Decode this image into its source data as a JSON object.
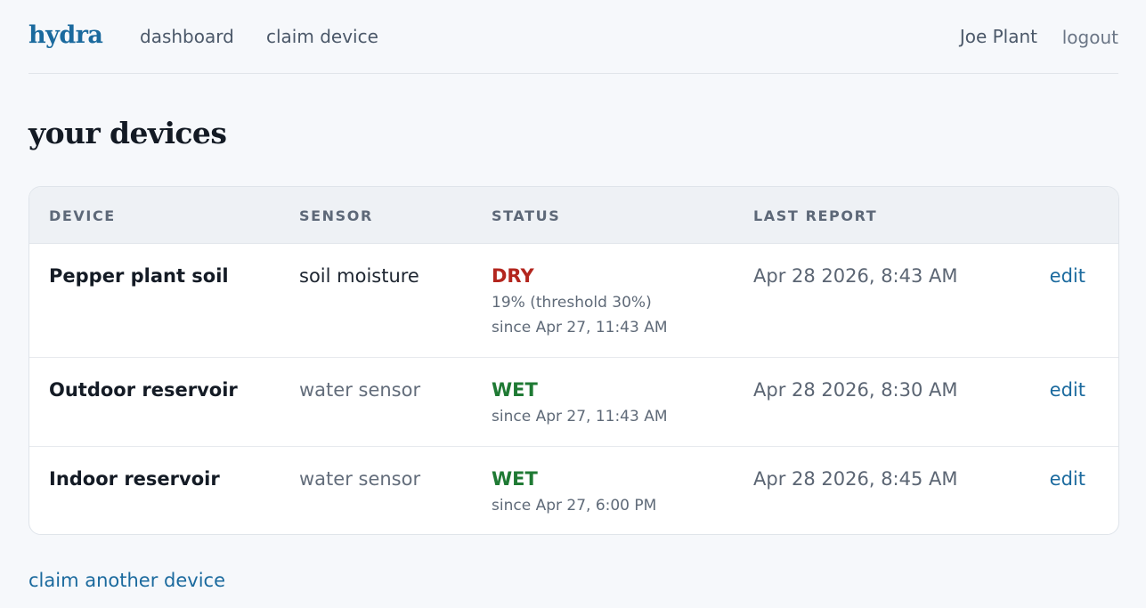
{
  "header": {
    "brand": "hydra",
    "nav": {
      "dashboard": "dashboard",
      "claim_device": "claim device"
    },
    "user_name": "Joe Plant",
    "logout": "logout"
  },
  "page_title": "your devices",
  "table": {
    "columns": {
      "device": "DEVICE",
      "sensor": "SENSOR",
      "status": "STATUS",
      "last_report": "LAST REPORT"
    },
    "rows": [
      {
        "device": "Pepper plant soil",
        "sensor": "soil moisture",
        "status": "DRY",
        "status_detail_1": "19% (threshold 30%)",
        "status_detail_2": "since Apr 27, 11:43 AM",
        "last_report": "Apr 28 2026, 8:43 AM",
        "action": "edit"
      },
      {
        "device": "Outdoor reservoir",
        "sensor": "water sensor",
        "status": "WET",
        "status_detail_1": "since Apr 27, 11:43 AM",
        "last_report": "Apr 28 2026, 8:30 AM",
        "action": "edit"
      },
      {
        "device": "Indoor reservoir",
        "sensor": "water sensor",
        "status": "WET",
        "status_detail_1": "since Apr 27, 6:00 PM",
        "last_report": "Apr 28 2026, 8:45 AM",
        "action": "edit"
      }
    ]
  },
  "footer_link": "claim another device",
  "colors": {
    "accent": "#1b6a9e",
    "status_dry": "#b3261e",
    "status_wet": "#1f7a34",
    "background": "#f6f8fb"
  }
}
